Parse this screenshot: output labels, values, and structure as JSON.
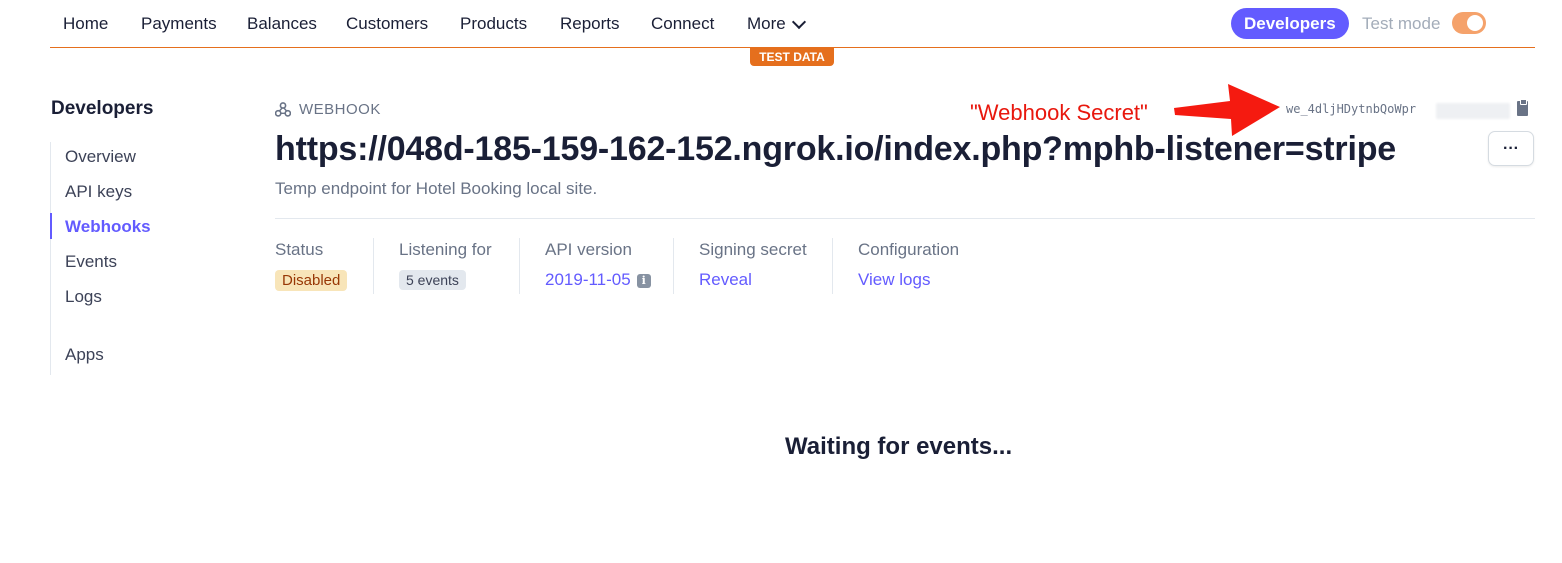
{
  "nav": {
    "items": [
      {
        "label": "Home"
      },
      {
        "label": "Payments"
      },
      {
        "label": "Balances"
      },
      {
        "label": "Customers"
      },
      {
        "label": "Products"
      },
      {
        "label": "Reports"
      },
      {
        "label": "Connect"
      },
      {
        "label": "More"
      }
    ],
    "developers_label": "Developers",
    "test_mode_label": "Test mode",
    "test_data_label": "TEST DATA",
    "accent_color": "#635bff",
    "test_color": "#e56f1d"
  },
  "sidebar": {
    "title": "Developers",
    "items": [
      {
        "label": "Overview",
        "active": false
      },
      {
        "label": "API keys",
        "active": false
      },
      {
        "label": "Webhooks",
        "active": true
      },
      {
        "label": "Events",
        "active": false
      },
      {
        "label": "Logs",
        "active": false
      },
      {
        "label": "Apps",
        "active": false
      }
    ]
  },
  "webhook": {
    "label": "WEBHOOK",
    "url": "https://048d-185-159-162-152.ngrok.io/index.php?mphb-listener=stripe",
    "description": "Temp endpoint for Hotel Booking local site.",
    "id_partial": "we_4dljHDytnbQoWpr",
    "more_label": "···"
  },
  "annotation": {
    "text": "\"Webhook Secret\"",
    "color": "#e8170d"
  },
  "details": {
    "status": {
      "label": "Status",
      "value": "Disabled"
    },
    "listening": {
      "label": "Listening for",
      "value": "5 events"
    },
    "api_version": {
      "label": "API version",
      "value": "2019-11-05"
    },
    "signing_secret": {
      "label": "Signing secret",
      "value": "Reveal"
    },
    "configuration": {
      "label": "Configuration",
      "value": "View logs"
    }
  },
  "events": {
    "waiting_text": "Waiting for events..."
  }
}
